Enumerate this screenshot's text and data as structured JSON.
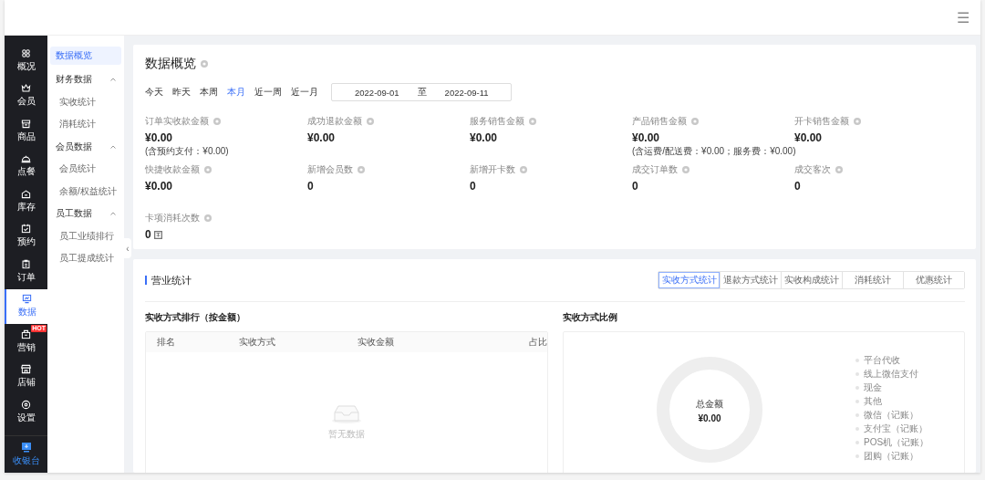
{
  "header": {
    "menu": "☰"
  },
  "collapse": "‹",
  "rail": [
    {
      "label": "概况",
      "selected": false
    },
    {
      "label": "会员",
      "selected": false
    },
    {
      "label": "商品",
      "selected": false
    },
    {
      "label": "点餐",
      "selected": false
    },
    {
      "label": "库存",
      "selected": false
    },
    {
      "label": "预约",
      "selected": false
    },
    {
      "label": "订单",
      "selected": false
    },
    {
      "label": "数据",
      "selected": true
    },
    {
      "label": "营销",
      "selected": false,
      "badge": "HOT"
    },
    {
      "label": "店铺",
      "selected": false
    },
    {
      "label": "设置",
      "selected": false
    }
  ],
  "cashier": {
    "label": "收银台"
  },
  "submenu": [
    {
      "label": "数据概览",
      "selected": true
    },
    {
      "label": "财务数据",
      "expanded": true,
      "children": [
        {
          "label": "实收统计",
          "selected": false
        },
        {
          "label": "消耗统计",
          "selected": false
        }
      ]
    },
    {
      "label": "会员数据",
      "expanded": true,
      "children": [
        {
          "label": "会员统计",
          "selected": false
        },
        {
          "label": "余额/权益统计",
          "selected": false
        }
      ]
    },
    {
      "label": "员工数据",
      "expanded": true,
      "children": [
        {
          "label": "员工业绩排行",
          "selected": false
        },
        {
          "label": "员工提成统计",
          "selected": false
        }
      ]
    }
  ],
  "overview": {
    "title": "数据概览",
    "ranges": [
      {
        "label": "今天",
        "selected": false
      },
      {
        "label": "昨天",
        "selected": false
      },
      {
        "label": "本周",
        "selected": false
      },
      {
        "label": "本月",
        "selected": true
      },
      {
        "label": "近一周",
        "selected": false
      },
      {
        "label": "近一月",
        "selected": false
      }
    ],
    "date_from": "2022-09-01",
    "date_sep": "至",
    "date_to": "2022-09-11",
    "stats": [
      {
        "label": "订单实收款金额",
        "value": "¥0.00",
        "note": "(含预约支付：¥0.00)"
      },
      {
        "label": "成功退款金额",
        "value": "¥0.00"
      },
      {
        "label": "服务销售金额",
        "value": "¥0.00"
      },
      {
        "label": "产品销售金额",
        "value": "¥0.00",
        "note": "(含运费/配送费：¥0.00；服务费：¥0.00)"
      },
      {
        "label": "开卡销售金额",
        "value": "¥0.00"
      },
      {
        "label": "快捷收款金额",
        "value": "¥0.00"
      },
      {
        "label": "新增会员数",
        "value": "0"
      },
      {
        "label": "新增开卡数",
        "value": "0"
      },
      {
        "label": "成交订单数",
        "value": "0"
      },
      {
        "label": "成交客次",
        "value": "0"
      },
      {
        "label": "卡项消耗次数",
        "value": "0",
        "unit_icon": true
      }
    ]
  },
  "business": {
    "title": "营业统计",
    "tabs": [
      {
        "label": "实收方式统计",
        "selected": true
      },
      {
        "label": "退款方式统计",
        "selected": false
      },
      {
        "label": "实收构成统计",
        "selected": false
      },
      {
        "label": "消耗统计",
        "selected": false
      },
      {
        "label": "优惠统计",
        "selected": false
      }
    ],
    "ranking": {
      "title": "实收方式排行（按金额）",
      "columns": [
        "排名",
        "实收方式",
        "实收金额",
        "占比"
      ],
      "empty": "暂无数据"
    },
    "ratio": {
      "title": "实收方式比例",
      "center_label": "总金额",
      "center_value": "¥0.00",
      "legend": [
        "平台代收",
        "线上微信支付",
        "现金",
        "其他",
        "微信（记账）",
        "支付宝（记账）",
        "POS机（记账）",
        "团购（记账）"
      ]
    }
  }
}
